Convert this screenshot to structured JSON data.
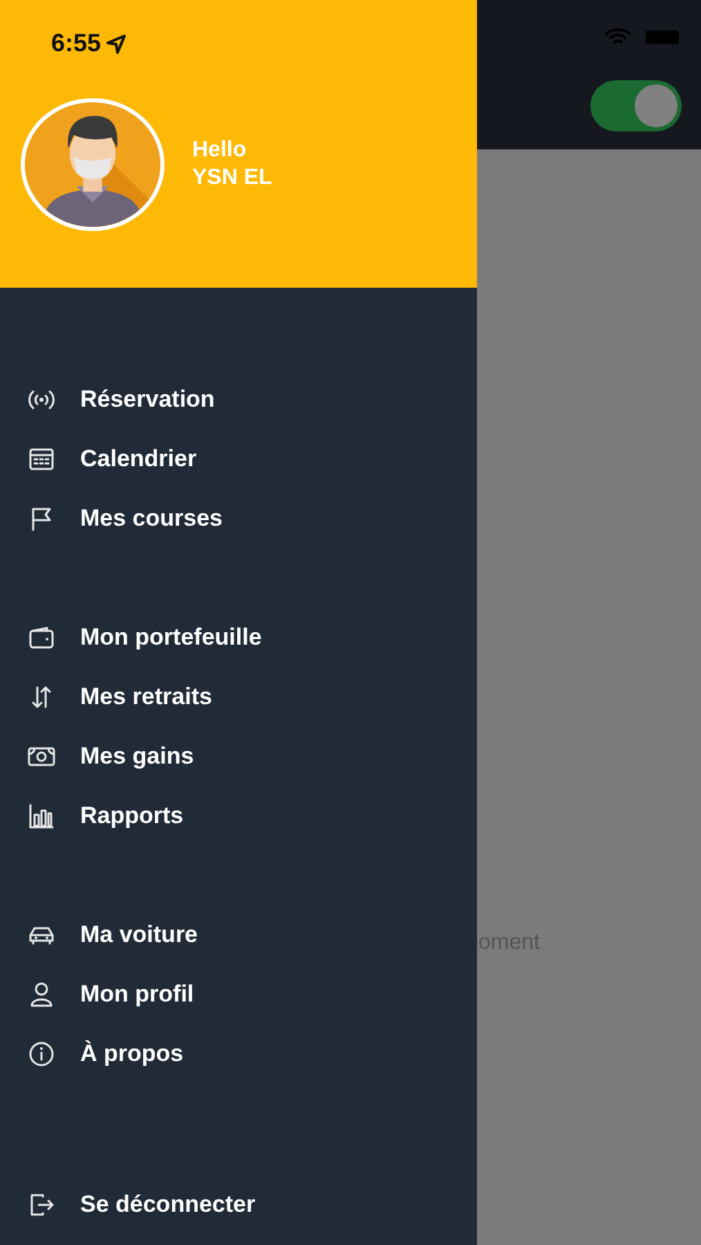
{
  "status_bar": {
    "time": "6:55"
  },
  "header": {
    "greeting": "Hello",
    "user_name": "YSN EL"
  },
  "background_screen": {
    "toggle_on": true,
    "partial_text": "oment"
  },
  "menu_sections": [
    {
      "items": [
        {
          "label": "Réservation"
        },
        {
          "label": "Calendrier"
        },
        {
          "label": "Mes courses"
        }
      ]
    },
    {
      "items": [
        {
          "label": "Mon portefeuille"
        },
        {
          "label": "Mes retraits"
        },
        {
          "label": "Mes gains"
        },
        {
          "label": "Rapports"
        }
      ]
    },
    {
      "items": [
        {
          "label": "Ma voiture"
        },
        {
          "label": "Mon profil"
        },
        {
          "label": "À propos"
        }
      ]
    }
  ],
  "logout": {
    "label": "Se déconnecter"
  }
}
